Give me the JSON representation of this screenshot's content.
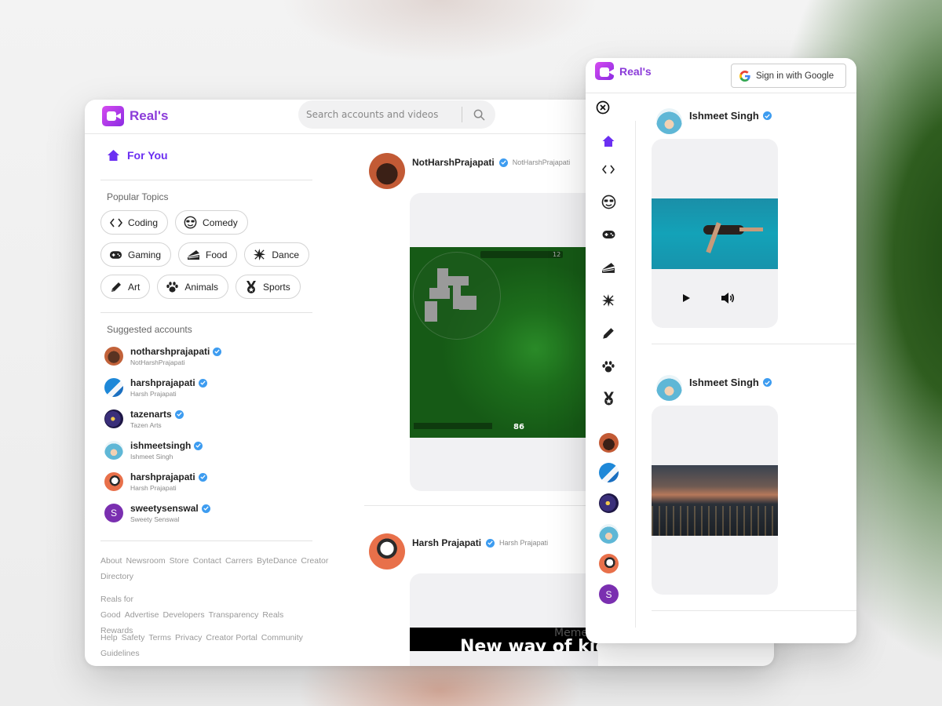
{
  "brand": {
    "name": "Real's"
  },
  "search": {
    "placeholder": "Search accounts and videos"
  },
  "nav": {
    "for_you": "For You"
  },
  "topics": {
    "title": "Popular Topics",
    "items": [
      {
        "label": "Coding",
        "icon": "code-icon"
      },
      {
        "label": "Comedy",
        "icon": "sunglasses-smiley-icon"
      },
      {
        "label": "Gaming",
        "icon": "gamepad-icon"
      },
      {
        "label": "Food",
        "icon": "cake-icon"
      },
      {
        "label": "Dance",
        "icon": "disco-icon"
      },
      {
        "label": "Art",
        "icon": "pencil-icon"
      },
      {
        "label": "Animals",
        "icon": "paw-icon"
      },
      {
        "label": "Sports",
        "icon": "medal-icon"
      }
    ]
  },
  "suggested": {
    "title": "Suggested accounts",
    "accounts": [
      {
        "username": "notharshprajapati",
        "name": "NotHarshPrajapati"
      },
      {
        "username": "harshprajapati",
        "name": "Harsh Prajapati"
      },
      {
        "username": "tazenarts",
        "name": "Tazen Arts"
      },
      {
        "username": "ishmeetsingh",
        "name": "Ishmeet Singh"
      },
      {
        "username": "harshprajapati",
        "name": "Harsh Prajapati"
      },
      {
        "username": "sweetysenswal",
        "name": "Sweety Senswal",
        "initial": "S"
      }
    ]
  },
  "footer": {
    "rows": [
      [
        "About",
        "Newsroom",
        "Store",
        "Contact",
        "Carrers",
        "ByteDance",
        "Creator Directory"
      ],
      [
        "Reals for Good",
        "Advertise",
        "Developers",
        "Transparency",
        "Reals Rewards"
      ],
      [
        "Help",
        "Safety",
        "Terms",
        "Privacy",
        "Creator Portal",
        "Community Guidelines"
      ]
    ]
  },
  "feed": [
    {
      "display_name": "NotHarshPrajapati",
      "username": "NotHarshPrajapati",
      "hud_health": "86",
      "hud_score": "12"
    },
    {
      "display_name": "Harsh Prajapati",
      "username": "Harsh Prajapati",
      "caption_top": "Meme",
      "caption": "New way of kidnapping"
    }
  ],
  "mobile": {
    "sign_in": "Sign in with Google",
    "posts": [
      {
        "display_name": "Ishmeet Singh"
      },
      {
        "display_name": "Ishmeet Singh"
      }
    ]
  },
  "colors": {
    "accent": "#6b2ff2",
    "brand": "#8b3bd9",
    "verified": "#3d9cf0"
  }
}
